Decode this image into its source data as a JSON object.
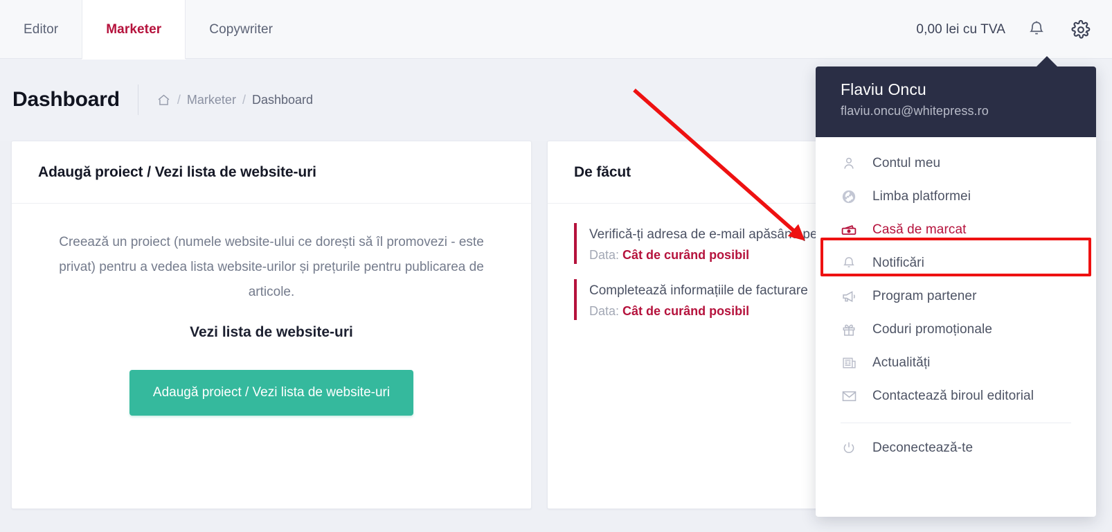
{
  "topbar": {
    "tabs": [
      {
        "label": "Editor",
        "active": false
      },
      {
        "label": "Marketer",
        "active": true
      },
      {
        "label": "Copywriter",
        "active": false
      }
    ],
    "balance": "0,00 lei cu TVA",
    "notifications_icon": "bell-icon",
    "settings_icon": "gear-icon"
  },
  "page": {
    "title": "Dashboard",
    "breadcrumb": {
      "home_icon": "home-icon",
      "sep": "/",
      "items": [
        "Marketer",
        "Dashboard"
      ]
    }
  },
  "cards": {
    "project": {
      "title": "Adaugă proiect / Vezi lista de website-uri",
      "intro": "Creează un proiect (numele website-ului ce dorești să îl promovezi - este privat) pentru a vedea lista website-urilor și prețurile pentru publicarea de articole.",
      "subtitle": "Vezi lista de website-uri",
      "button_label": "Adaugă proiect / Vezi lista de website-uri",
      "button_color": "#35b99d"
    },
    "todo": {
      "title": "De făcut",
      "items": [
        {
          "text": "Verifică-ți adresa de e-mail apăsând pe link-ul primit în mesaj.",
          "date_label": "Data:",
          "date_value": "Cât de curând posibil"
        },
        {
          "text": "Completează informațiile de facturare",
          "date_label": "Data:",
          "date_value": "Cât de curând posibil"
        }
      ],
      "accent_color": "#b5123c"
    }
  },
  "settings_dropdown": {
    "user_name": "Flaviu Oncu",
    "user_email": "flaviu.oncu@whitepress.ro",
    "header_bg": "#2a2e45",
    "items": [
      {
        "label": "Contul meu",
        "icon": "user-icon",
        "highlighted": false
      },
      {
        "label": "Limba platformei",
        "icon": "globe-icon",
        "highlighted": false
      },
      {
        "label": "Casă de marcat",
        "icon": "cash-register-icon",
        "highlighted": true
      },
      {
        "label": "Notificări",
        "icon": "bell-icon",
        "highlighted": false
      },
      {
        "label": "Program partener",
        "icon": "megaphone-icon",
        "highlighted": false
      },
      {
        "label": "Coduri promoționale",
        "icon": "gift-icon",
        "highlighted": false
      },
      {
        "label": "Actualități",
        "icon": "newspaper-icon",
        "highlighted": false
      },
      {
        "label": "Contactează biroul editorial",
        "icon": "envelope-icon",
        "highlighted": false
      }
    ],
    "logout": {
      "label": "Deconectează-te",
      "icon": "power-icon"
    }
  },
  "annotation": {
    "highlight_color": "#ee1111",
    "target_label": "Casă de marcat"
  }
}
